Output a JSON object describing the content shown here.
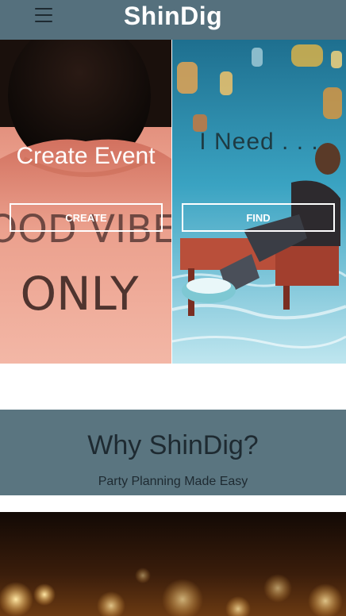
{
  "header": {
    "brand": "ShinDig",
    "menu_icon": "hamburger-menu-icon"
  },
  "hero": {
    "create": {
      "title": "Create Event",
      "button_label": "CREATE",
      "photo_text": [
        "GOOD VIBES",
        "ONLY"
      ]
    },
    "find": {
      "title": "I Need . . .",
      "button_label": "FIND"
    }
  },
  "why": {
    "title": "Why ShinDig?",
    "subtitle": "Party Planning Made Easy"
  },
  "colors": {
    "header_bg": "#55707d",
    "section_bg": "#5a7580",
    "dark_text": "#1e2a31"
  }
}
